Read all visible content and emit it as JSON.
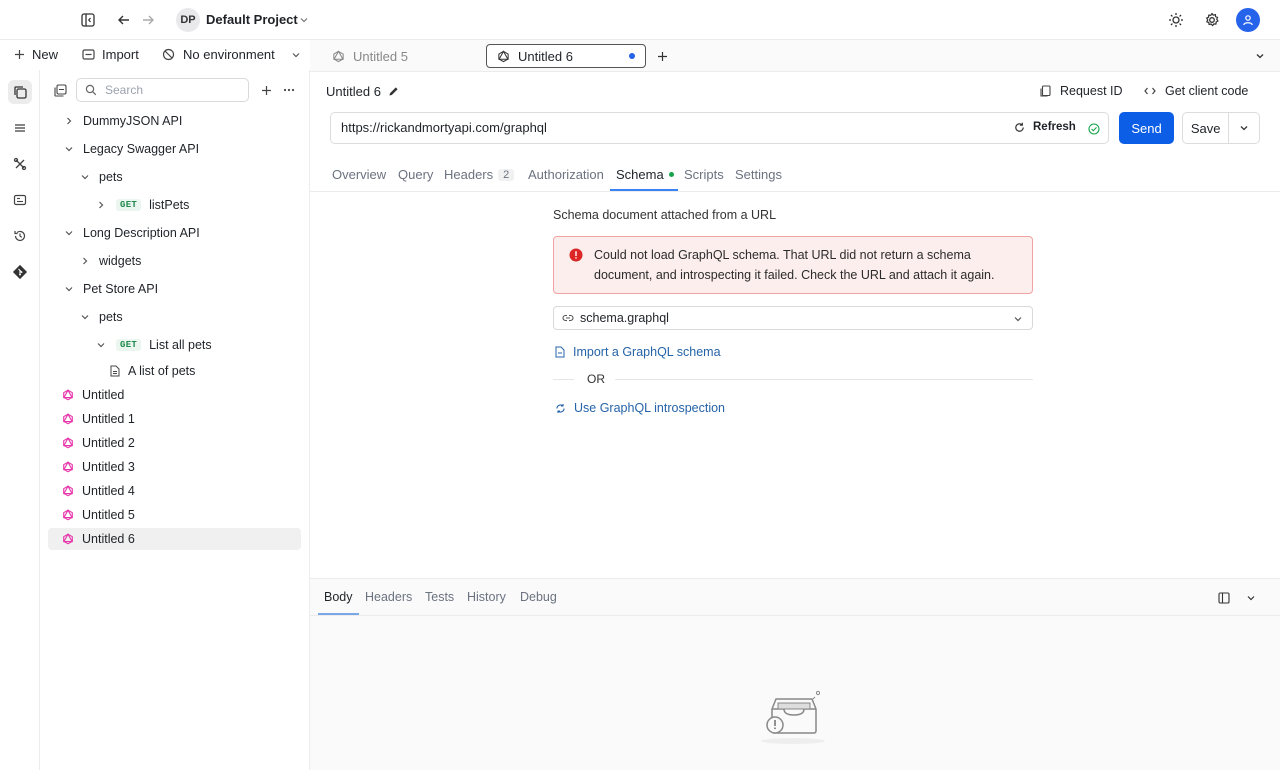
{
  "topbar": {
    "project_initials": "DP",
    "project_name": "Default Project"
  },
  "actions": {
    "new_label": "New",
    "import_label": "Import",
    "environment_label": "No environment"
  },
  "sidebar": {
    "search_placeholder": "Search",
    "tree": [
      {
        "label": "DummyJSON API",
        "type": "collection",
        "expanded": false
      },
      {
        "label": "Legacy Swagger API",
        "type": "collection",
        "expanded": true
      },
      {
        "label": "pets",
        "type": "folder",
        "expanded": true
      },
      {
        "label": "listPets",
        "type": "request",
        "method": "GET"
      },
      {
        "label": "Long Description API",
        "type": "collection",
        "expanded": true
      },
      {
        "label": "widgets",
        "type": "folder",
        "expanded": false
      },
      {
        "label": "Pet Store API",
        "type": "collection",
        "expanded": true
      },
      {
        "label": "pets",
        "type": "folder",
        "expanded": true
      },
      {
        "label": "List all pets",
        "type": "request",
        "method": "GET"
      },
      {
        "label": "A list of pets",
        "type": "doc"
      },
      {
        "label": "Untitled",
        "type": "graphql"
      },
      {
        "label": "Untitled 1",
        "type": "graphql"
      },
      {
        "label": "Untitled 2",
        "type": "graphql"
      },
      {
        "label": "Untitled 3",
        "type": "graphql"
      },
      {
        "label": "Untitled 4",
        "type": "graphql"
      },
      {
        "label": "Untitled 5",
        "type": "graphql"
      },
      {
        "label": "Untitled 6",
        "type": "graphql",
        "selected": true
      }
    ]
  },
  "tabs": [
    {
      "label": "Untitled 5",
      "active": false
    },
    {
      "label": "Untitled 6",
      "active": true,
      "unsaved": true
    }
  ],
  "request": {
    "name": "Untitled 6",
    "request_id_label": "Request ID",
    "client_code_label": "Get client code",
    "url": "https://rickandmortyapi.com/graphql",
    "refresh_label": "Refresh",
    "send_label": "Send",
    "save_label": "Save"
  },
  "subtabs": {
    "overview": "Overview",
    "query": "Query",
    "headers": "Headers",
    "headers_count": "2",
    "authorization": "Authorization",
    "schema": "Schema",
    "scripts": "Scripts",
    "settings": "Settings"
  },
  "schema": {
    "heading": "Schema document attached from a URL",
    "error_message": "Could not load GraphQL schema. That URL did not return a schema document, and introspecting it failed. Check the URL and attach it again.",
    "selected_file": "schema.graphql",
    "import_link": "Import a GraphQL schema",
    "or_label": "OR",
    "introspection_link": "Use GraphQL introspection"
  },
  "response": {
    "tabs": [
      "Body",
      "Headers",
      "Tests",
      "History",
      "Debug"
    ],
    "active_tab": "Body"
  },
  "colors": {
    "accent": "#0b5ee5",
    "graphql_pink": "#e535ab",
    "get_green": "#1f8a4c",
    "error_red": "#dc2626",
    "link_blue": "#2563a8",
    "success_green": "#16a34a"
  }
}
